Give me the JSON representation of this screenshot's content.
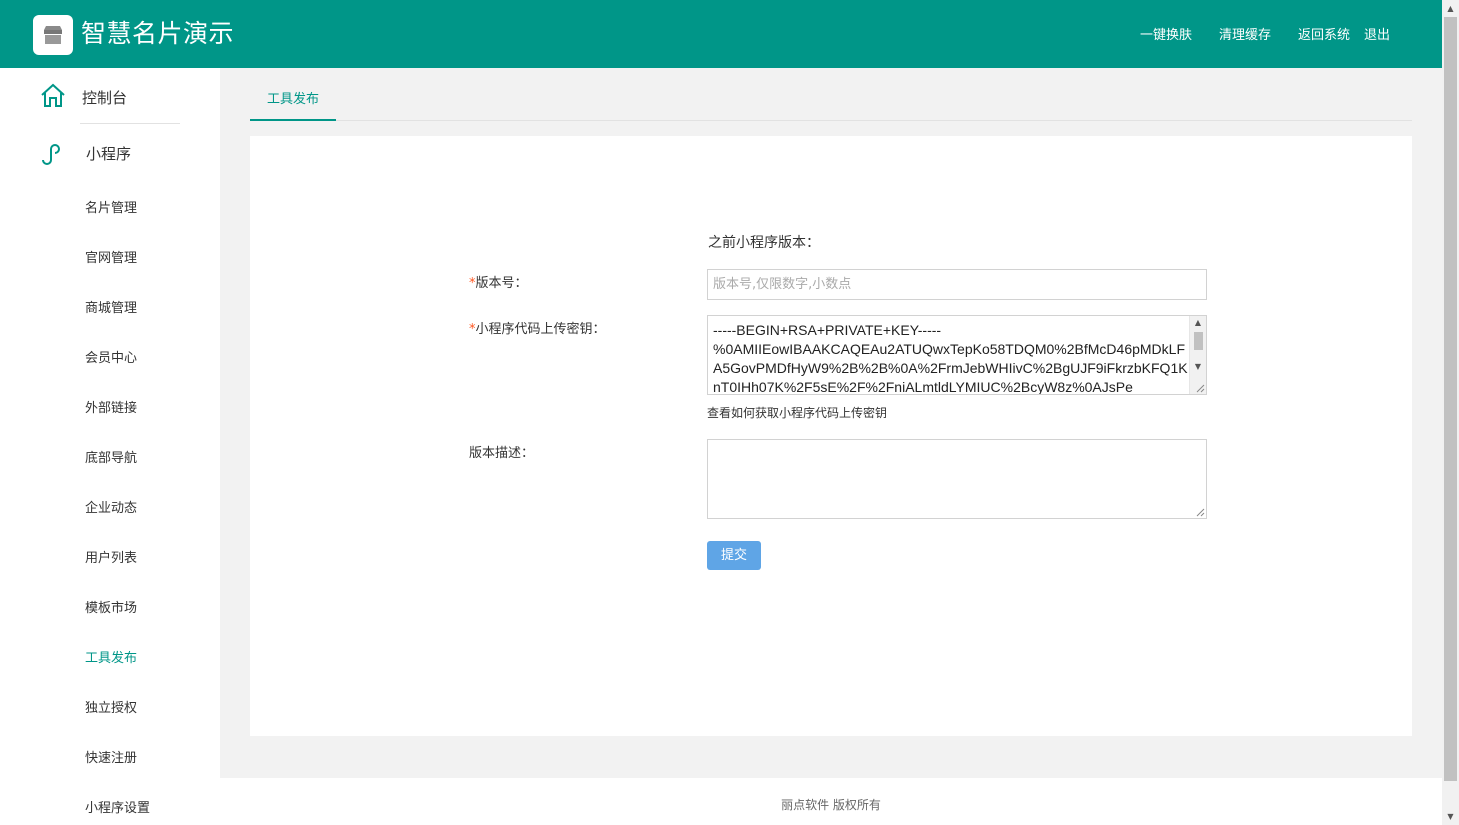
{
  "header": {
    "brand": "智慧名片演示",
    "links": {
      "skin": "一键换肤",
      "cache": "清理缓存",
      "back": "返回系统",
      "logout": "退出"
    },
    "bg_color": "#009688"
  },
  "sidebar": {
    "console": "控制台",
    "miniprogram": "小程序",
    "items": [
      {
        "label": "名片管理",
        "active": false
      },
      {
        "label": "官网管理",
        "active": false
      },
      {
        "label": "商城管理",
        "active": false
      },
      {
        "label": "会员中心",
        "active": false
      },
      {
        "label": "外部链接",
        "active": false
      },
      {
        "label": "底部导航",
        "active": false
      },
      {
        "label": "企业动态",
        "active": false
      },
      {
        "label": "用户列表",
        "active": false
      },
      {
        "label": "模板市场",
        "active": false
      },
      {
        "label": "工具发布",
        "active": true
      },
      {
        "label": "独立授权",
        "active": false
      },
      {
        "label": "快速注册",
        "active": false
      },
      {
        "label": "小程序设置",
        "active": false
      }
    ],
    "icons": [
      "home-icon",
      "miniprogram-icon"
    ]
  },
  "tabs": [
    "工具发布"
  ],
  "form": {
    "previous_version": "之前小程序版本：",
    "version_label": "版本号：",
    "version_placeholder": "版本号,仅限数字,小数点",
    "version_value": "",
    "key_label": "小程序代码上传密钥：",
    "key_value": "-----BEGIN+RSA+PRIVATE+KEY-----\n%0AMIIEowIBAAKCAQEAu2ATUQwxTepKo58TDQM0%2BfMcD46pMDkLFA5GovPMDfHyW9%2B%2B%0A%2FrmJebWHIivC%2BgUJF9iFkrzbKFQ1KnT0IHh07K%2F5sE%2F%2FniALmtldLYMIUC%2BcyW8z%0AJsPe",
    "key_help": "查看如何获取小程序代码上传密钥",
    "desc_label": "版本描述：",
    "desc_value": "",
    "submit": "提交",
    "required_mark": "*"
  },
  "footer": "丽点软件 版权所有",
  "colors": {
    "accent": "#009688",
    "required": "#ff5722",
    "submit": "#5fa5e6"
  }
}
